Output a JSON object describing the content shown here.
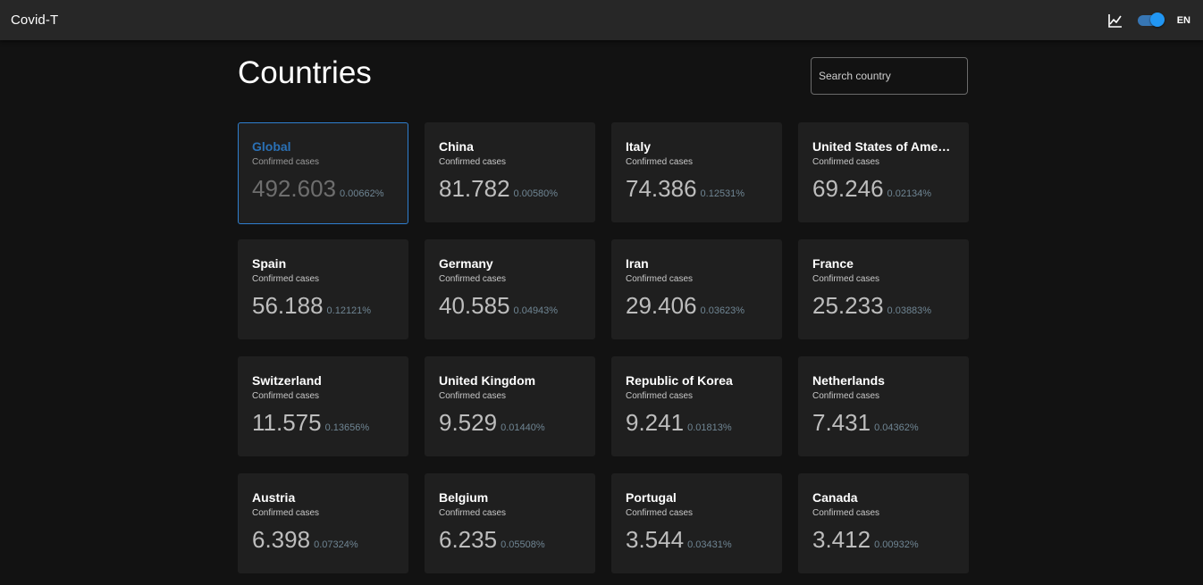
{
  "app": {
    "title": "Covid-T",
    "lang": "EN"
  },
  "page": {
    "title": "Countries"
  },
  "search": {
    "placeholder": "Search country",
    "value": ""
  },
  "theme_toggle": {
    "on": true
  },
  "colors": {
    "accent": "#2196f3",
    "selected_border": "#2f7fcf",
    "selected_name": "#2a70b5",
    "card_bg": "#1f1f1f",
    "page_bg": "#121212"
  },
  "cards": [
    {
      "name": "Global",
      "sub": "Confirmed cases",
      "value": "492.603",
      "pct": "0.00662%",
      "selected": true
    },
    {
      "name": "China",
      "sub": "Confirmed cases",
      "value": "81.782",
      "pct": "0.00580%"
    },
    {
      "name": "Italy",
      "sub": "Confirmed cases",
      "value": "74.386",
      "pct": "0.12531%"
    },
    {
      "name": "United States of America",
      "sub": "Confirmed cases",
      "value": "69.246",
      "pct": "0.02134%"
    },
    {
      "name": "Spain",
      "sub": "Confirmed cases",
      "value": "56.188",
      "pct": "0.12121%"
    },
    {
      "name": "Germany",
      "sub": "Confirmed cases",
      "value": "40.585",
      "pct": "0.04943%"
    },
    {
      "name": "Iran",
      "sub": "Confirmed cases",
      "value": "29.406",
      "pct": "0.03623%"
    },
    {
      "name": "France",
      "sub": "Confirmed cases",
      "value": "25.233",
      "pct": "0.03883%"
    },
    {
      "name": "Switzerland",
      "sub": "Confirmed cases",
      "value": "11.575",
      "pct": "0.13656%"
    },
    {
      "name": "United Kingdom",
      "sub": "Confirmed cases",
      "value": "9.529",
      "pct": "0.01440%"
    },
    {
      "name": "Republic of Korea",
      "sub": "Confirmed cases",
      "value": "9.241",
      "pct": "0.01813%"
    },
    {
      "name": "Netherlands",
      "sub": "Confirmed cases",
      "value": "7.431",
      "pct": "0.04362%"
    },
    {
      "name": "Austria",
      "sub": "Confirmed cases",
      "value": "6.398",
      "pct": "0.07324%"
    },
    {
      "name": "Belgium",
      "sub": "Confirmed cases",
      "value": "6.235",
      "pct": "0.05508%"
    },
    {
      "name": "Portugal",
      "sub": "Confirmed cases",
      "value": "3.544",
      "pct": "0.03431%"
    },
    {
      "name": "Canada",
      "sub": "Confirmed cases",
      "value": "3.412",
      "pct": "0.00932%"
    }
  ]
}
